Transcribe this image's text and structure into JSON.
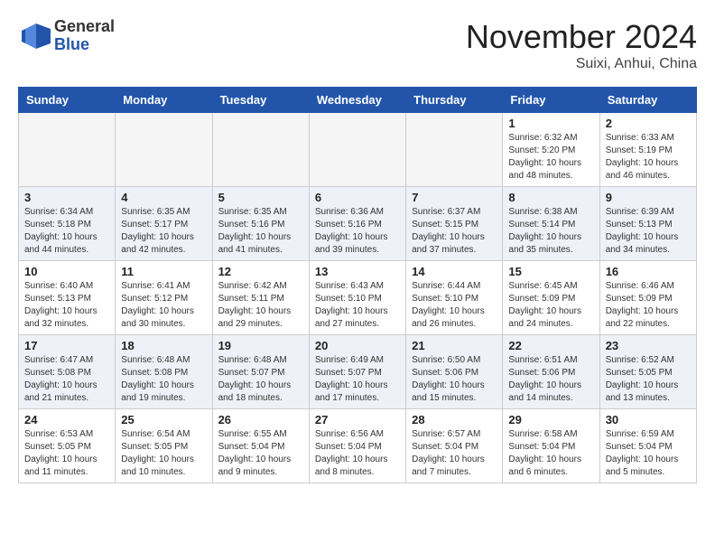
{
  "header": {
    "logo_general": "General",
    "logo_blue": "Blue",
    "month": "November 2024",
    "location": "Suixi, Anhui, China"
  },
  "weekdays": [
    "Sunday",
    "Monday",
    "Tuesday",
    "Wednesday",
    "Thursday",
    "Friday",
    "Saturday"
  ],
  "weeks": [
    [
      {
        "day": "",
        "info": ""
      },
      {
        "day": "",
        "info": ""
      },
      {
        "day": "",
        "info": ""
      },
      {
        "day": "",
        "info": ""
      },
      {
        "day": "",
        "info": ""
      },
      {
        "day": "1",
        "info": "Sunrise: 6:32 AM\nSunset: 5:20 PM\nDaylight: 10 hours\nand 48 minutes."
      },
      {
        "day": "2",
        "info": "Sunrise: 6:33 AM\nSunset: 5:19 PM\nDaylight: 10 hours\nand 46 minutes."
      }
    ],
    [
      {
        "day": "3",
        "info": "Sunrise: 6:34 AM\nSunset: 5:18 PM\nDaylight: 10 hours\nand 44 minutes."
      },
      {
        "day": "4",
        "info": "Sunrise: 6:35 AM\nSunset: 5:17 PM\nDaylight: 10 hours\nand 42 minutes."
      },
      {
        "day": "5",
        "info": "Sunrise: 6:35 AM\nSunset: 5:16 PM\nDaylight: 10 hours\nand 41 minutes."
      },
      {
        "day": "6",
        "info": "Sunrise: 6:36 AM\nSunset: 5:16 PM\nDaylight: 10 hours\nand 39 minutes."
      },
      {
        "day": "7",
        "info": "Sunrise: 6:37 AM\nSunset: 5:15 PM\nDaylight: 10 hours\nand 37 minutes."
      },
      {
        "day": "8",
        "info": "Sunrise: 6:38 AM\nSunset: 5:14 PM\nDaylight: 10 hours\nand 35 minutes."
      },
      {
        "day": "9",
        "info": "Sunrise: 6:39 AM\nSunset: 5:13 PM\nDaylight: 10 hours\nand 34 minutes."
      }
    ],
    [
      {
        "day": "10",
        "info": "Sunrise: 6:40 AM\nSunset: 5:13 PM\nDaylight: 10 hours\nand 32 minutes."
      },
      {
        "day": "11",
        "info": "Sunrise: 6:41 AM\nSunset: 5:12 PM\nDaylight: 10 hours\nand 30 minutes."
      },
      {
        "day": "12",
        "info": "Sunrise: 6:42 AM\nSunset: 5:11 PM\nDaylight: 10 hours\nand 29 minutes."
      },
      {
        "day": "13",
        "info": "Sunrise: 6:43 AM\nSunset: 5:10 PM\nDaylight: 10 hours\nand 27 minutes."
      },
      {
        "day": "14",
        "info": "Sunrise: 6:44 AM\nSunset: 5:10 PM\nDaylight: 10 hours\nand 26 minutes."
      },
      {
        "day": "15",
        "info": "Sunrise: 6:45 AM\nSunset: 5:09 PM\nDaylight: 10 hours\nand 24 minutes."
      },
      {
        "day": "16",
        "info": "Sunrise: 6:46 AM\nSunset: 5:09 PM\nDaylight: 10 hours\nand 22 minutes."
      }
    ],
    [
      {
        "day": "17",
        "info": "Sunrise: 6:47 AM\nSunset: 5:08 PM\nDaylight: 10 hours\nand 21 minutes."
      },
      {
        "day": "18",
        "info": "Sunrise: 6:48 AM\nSunset: 5:08 PM\nDaylight: 10 hours\nand 19 minutes."
      },
      {
        "day": "19",
        "info": "Sunrise: 6:48 AM\nSunset: 5:07 PM\nDaylight: 10 hours\nand 18 minutes."
      },
      {
        "day": "20",
        "info": "Sunrise: 6:49 AM\nSunset: 5:07 PM\nDaylight: 10 hours\nand 17 minutes."
      },
      {
        "day": "21",
        "info": "Sunrise: 6:50 AM\nSunset: 5:06 PM\nDaylight: 10 hours\nand 15 minutes."
      },
      {
        "day": "22",
        "info": "Sunrise: 6:51 AM\nSunset: 5:06 PM\nDaylight: 10 hours\nand 14 minutes."
      },
      {
        "day": "23",
        "info": "Sunrise: 6:52 AM\nSunset: 5:05 PM\nDaylight: 10 hours\nand 13 minutes."
      }
    ],
    [
      {
        "day": "24",
        "info": "Sunrise: 6:53 AM\nSunset: 5:05 PM\nDaylight: 10 hours\nand 11 minutes."
      },
      {
        "day": "25",
        "info": "Sunrise: 6:54 AM\nSunset: 5:05 PM\nDaylight: 10 hours\nand 10 minutes."
      },
      {
        "day": "26",
        "info": "Sunrise: 6:55 AM\nSunset: 5:04 PM\nDaylight: 10 hours\nand 9 minutes."
      },
      {
        "day": "27",
        "info": "Sunrise: 6:56 AM\nSunset: 5:04 PM\nDaylight: 10 hours\nand 8 minutes."
      },
      {
        "day": "28",
        "info": "Sunrise: 6:57 AM\nSunset: 5:04 PM\nDaylight: 10 hours\nand 7 minutes."
      },
      {
        "day": "29",
        "info": "Sunrise: 6:58 AM\nSunset: 5:04 PM\nDaylight: 10 hours\nand 6 minutes."
      },
      {
        "day": "30",
        "info": "Sunrise: 6:59 AM\nSunset: 5:04 PM\nDaylight: 10 hours\nand 5 minutes."
      }
    ]
  ]
}
